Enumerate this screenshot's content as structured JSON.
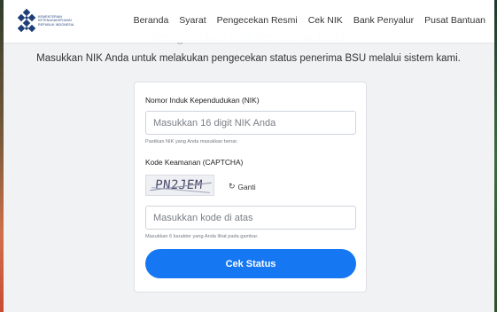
{
  "header": {
    "logo_lines": [
      "KEMENTERIAN",
      "KETENAGAKERJAAN",
      "REPUBLIK INDONESIA"
    ],
    "nav": [
      "Beranda",
      "Syarat",
      "Pengecekan Resmi",
      "Cek NIK",
      "Bank Penyalur",
      "Pusat Bantuan"
    ]
  },
  "page": {
    "title": "Pengecekan NIK Penerima BSU",
    "subtitle": "Masukkan NIK Anda untuk melakukan pengecekan status penerima BSU melalui sistem kami."
  },
  "form": {
    "nik_label": "Nomor Induk Kependudukan (NIK)",
    "nik_placeholder": "Masukkan 16 digit NIK Anda",
    "nik_value": "",
    "nik_hint": "Pastikan NIK yang Anda masukkan benar.",
    "captcha_label": "Kode Keamanan (CAPTCHA)",
    "captcha_code": "PN2JEM",
    "refresh_label": "Ganti",
    "captcha_placeholder": "Masukkan kode di atas",
    "captcha_value": "",
    "captcha_hint": "Masukkan 6 karakter yang Anda lihat pada gambar.",
    "submit_label": "Cek Status"
  },
  "colors": {
    "primary": "#1677f2",
    "logo": "#1f3f7a",
    "background": "#f1f2f4"
  },
  "icons": {
    "logo": "kemnaker-logo-icon",
    "refresh": "refresh-icon"
  }
}
